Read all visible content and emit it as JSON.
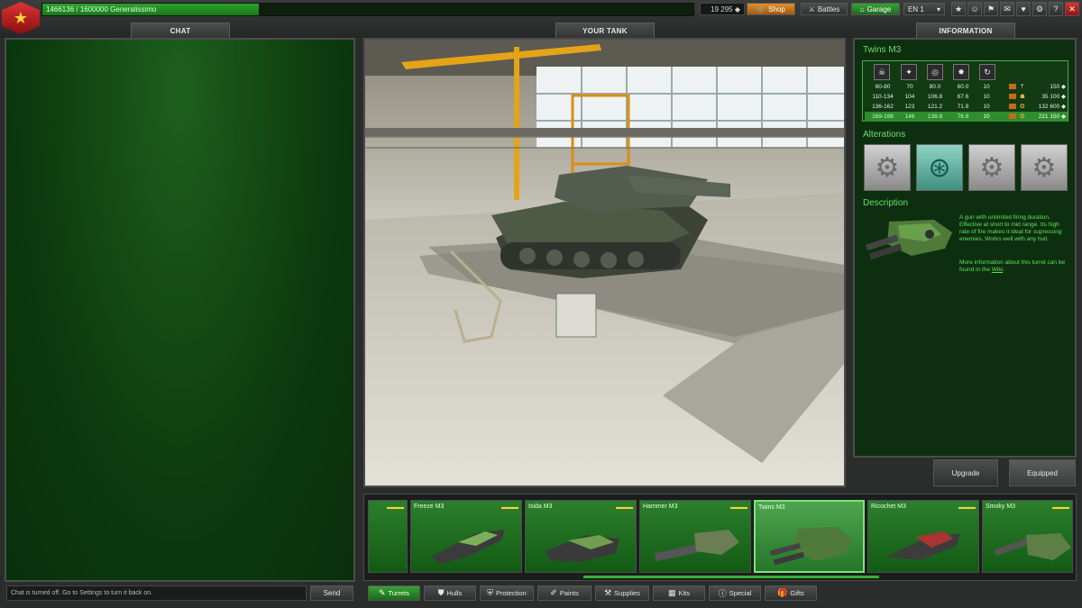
{
  "topbar": {
    "xp_text": "1466136 / 1600000  Generalissimo",
    "crystals": "19 295 ◆",
    "shop_label": "Shop",
    "battles_label": "Battles",
    "garage_label": "Garage",
    "language": "EN 1"
  },
  "tabs": {
    "chat": "CHAT",
    "your_tank": "YOUR TANK",
    "information": "INFORMATION"
  },
  "chat": {
    "placeholder": "Chat is turned off. Go to Settings to turn it back on.",
    "send_label": "Send"
  },
  "info": {
    "item_name": "Twins M3",
    "table_rows": [
      {
        "damage": "60-80",
        "c2": "70",
        "c3": "80.0",
        "c4": "60.0",
        "c5": "10",
        "price": "150 ◆"
      },
      {
        "damage": "110-134",
        "c2": "104",
        "c3": "106.8",
        "c4": "67.6",
        "c5": "10",
        "price": "35 100 ◆"
      },
      {
        "damage": "136-162",
        "c2": "123",
        "c3": "121.2",
        "c4": "71.8",
        "c5": "10",
        "price": "132 600 ◆"
      },
      {
        "damage": "169-198",
        "c2": "146",
        "c3": "138.8",
        "c4": "76.8",
        "c5": "10",
        "price": "221 150 ◆"
      }
    ],
    "alterations_title": "Alterations",
    "description_title": "Description",
    "description_text": "A gun with unlimited firing duration. Effective at short to mid range. Its high rate of fire makes it ideal for supressing enemies. Works well with any hull.",
    "more_info_text": "More information about this turret can be found in the",
    "wiki_link": "Wiki",
    "upgrade_label": "Upgrade",
    "equipped_label": "Equipped"
  },
  "items": [
    {
      "name": "Freeze M3"
    },
    {
      "name": "Isida M3"
    },
    {
      "name": "Hammer M3"
    },
    {
      "name": "Twins M3"
    },
    {
      "name": "Ricochet M3"
    },
    {
      "name": "Smoky M3"
    }
  ],
  "categories": [
    {
      "label": "Turrets"
    },
    {
      "label": "Hulls"
    },
    {
      "label": "Protection"
    },
    {
      "label": "Paints"
    },
    {
      "label": "Supplies"
    },
    {
      "label": "Kits"
    },
    {
      "label": "Special"
    },
    {
      "label": "Gifts"
    }
  ],
  "colors": {
    "accent_green": "#37a237",
    "shop_orange": "#e0902a",
    "close_red": "#d33333"
  }
}
